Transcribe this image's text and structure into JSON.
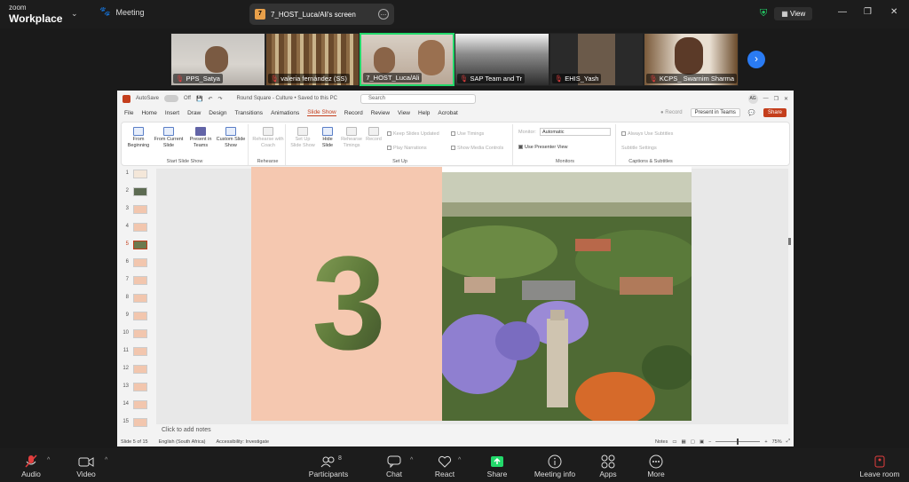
{
  "app": {
    "brand_small": "zoom",
    "brand_name": "Workplace",
    "meeting_tab": "Meeting"
  },
  "share_tab": {
    "badge": "7",
    "title": "7_HOST_Luca/Ali's screen"
  },
  "top_right": {
    "view_label": "View"
  },
  "participants_strip": [
    {
      "name": "PPS_Satya",
      "muted": true,
      "active": false
    },
    {
      "name": "valeria fernández (SS)",
      "muted": true,
      "active": false
    },
    {
      "name": "7_HOST_Luca/Ali",
      "muted": false,
      "active": true
    },
    {
      "name": "SAP Team and Tr",
      "muted": true,
      "active": false
    },
    {
      "name": "EHIS_Yash",
      "muted": true,
      "active": false
    },
    {
      "name": "KCPS_ Swarnim Sharma",
      "muted": true,
      "active": false
    }
  ],
  "ppt": {
    "autosave": "AutoSave",
    "autosave_state": "Off",
    "doc_title": "Round Square - Culture • Saved to this PC",
    "search_placeholder": "Search",
    "avatar": "AG",
    "menu": [
      "File",
      "Home",
      "Insert",
      "Draw",
      "Design",
      "Transitions",
      "Animations",
      "Slide Show",
      "Record",
      "Review",
      "View",
      "Help",
      "Acrobat"
    ],
    "menu_selected": "Slide Show",
    "record_label": "Record",
    "present_teams": "Present in Teams",
    "share_label": "Share",
    "ribbon": {
      "from_beginning": "From Beginning",
      "from_current": "From Current Slide",
      "present_teams": "Present in Teams",
      "custom_show": "Custom Slide Show",
      "group_start": "Start Slide Show",
      "rehearse_coach": "Rehearse with Coach",
      "group_rehearse": "Rehearse",
      "setup_show": "Set Up Slide Show",
      "hide_slide": "Hide Slide",
      "rehearse_timings": "Rehearse Timings",
      "record": "Record",
      "keep_updated": "Keep Slides Updated",
      "play_narrations": "Play Narrations",
      "use_timings": "Use Timings",
      "show_media": "Show Media Controls",
      "group_setup": "Set Up",
      "monitor_label": "Monitor:",
      "monitor_value": "Automatic",
      "presenter_view": "Use Presenter View",
      "group_monitors": "Monitors",
      "always_subtitles": "Always Use Subtitles",
      "subtitle_settings": "Subtitle Settings",
      "group_captions": "Captions & Subtitles"
    },
    "slides_count": 15,
    "current_slide": 5,
    "slide_numeral": "3",
    "notes_placeholder": "Click to add notes",
    "status": {
      "slide_of": "Slide 5 of 15",
      "language": "English (South Africa)",
      "accessibility": "Accessibility: Investigate",
      "notes": "Notes",
      "zoom": "75%"
    }
  },
  "bottom": {
    "audio": "Audio",
    "video": "Video",
    "participants": "Participants",
    "participants_count": "8",
    "chat": "Chat",
    "react": "React",
    "share": "Share",
    "meeting_info": "Meeting info",
    "apps": "Apps",
    "more": "More",
    "leave": "Leave room"
  },
  "colors": {
    "accent_green": "#23d96b",
    "ppt_accent": "#c43e1c",
    "slide_peach": "#f5c8b0"
  }
}
